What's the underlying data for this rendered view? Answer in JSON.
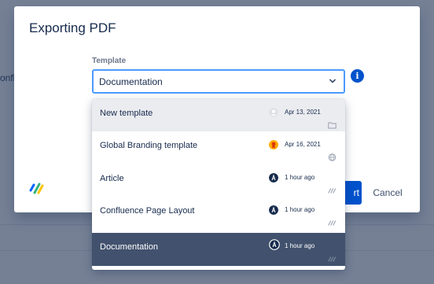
{
  "backdrop": {
    "partial_text": "onflu"
  },
  "modal": {
    "title": "Exporting PDF",
    "template_label": "Template",
    "selected_template": "Documentation",
    "export_label": "rt",
    "cancel_label": "Cancel"
  },
  "dropdown": {
    "options": [
      {
        "label": "New template",
        "date": "Apr 13, 2021",
        "avatar_icon": "default-avatar-icon",
        "kind_icon": "folder-icon",
        "state": "hover"
      },
      {
        "label": "Global Branding template",
        "date": "Apr 16, 2021",
        "avatar_icon": "badge-avatar-icon",
        "kind_icon": "globe-icon",
        "state": "normal"
      },
      {
        "label": "Article",
        "date": "1 hour ago",
        "avatar_icon": "user-avatar-icon",
        "kind_icon": "app-logo-icon",
        "state": "normal"
      },
      {
        "label": "Confluence Page Layout",
        "date": "1 hour ago",
        "avatar_icon": "user-avatar-icon",
        "kind_icon": "app-logo-icon",
        "state": "normal"
      },
      {
        "label": "Documentation",
        "date": "1 hour ago",
        "avatar_icon": "user-avatar-icon",
        "kind_icon": "app-logo-icon",
        "state": "selected"
      }
    ]
  },
  "colors": {
    "primary": "#0052cc",
    "focus_border": "#4c9aff",
    "selected_row": "#42526e",
    "hover_row": "#ebecf0"
  }
}
